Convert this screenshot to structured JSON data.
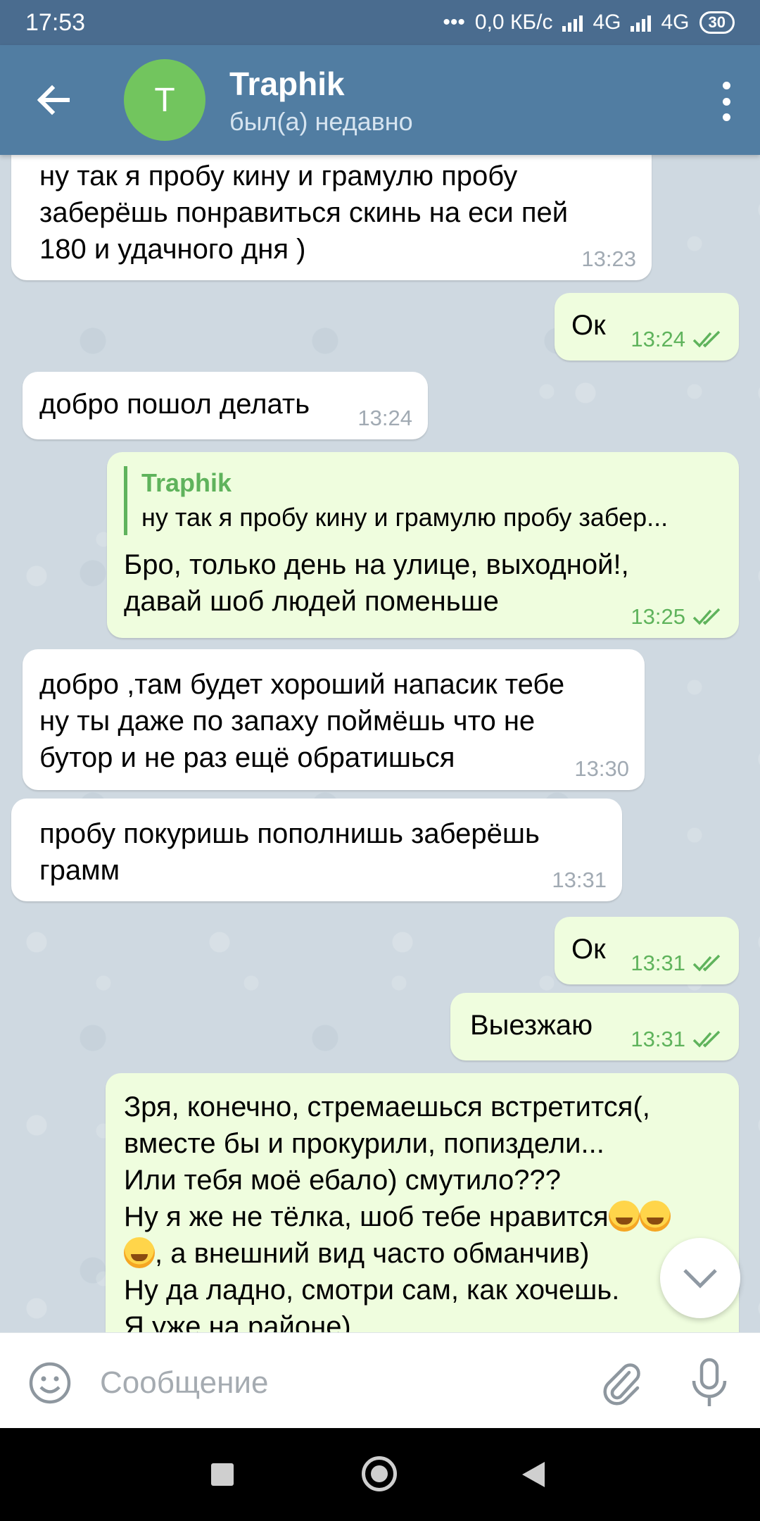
{
  "status_bar": {
    "time": "17:53",
    "dots": "•••",
    "network_speed": "0,0 КБ/с",
    "sim1": "4G",
    "sim2": "4G",
    "battery": "30"
  },
  "header": {
    "avatar_letter": "T",
    "title": "Traphik",
    "subtitle": "был(а) недавно"
  },
  "messages": [
    {
      "dir": "in",
      "text": "ну так я пробу кину и грамулю пробу\nзаберёшь понравиться скинь на еси пей\n180 и удачного дня )",
      "time": "13:23"
    },
    {
      "dir": "out",
      "text": "Ок",
      "time": "13:24"
    },
    {
      "dir": "in",
      "text": "добро пошол делать",
      "time": "13:24"
    },
    {
      "dir": "out",
      "reply_name": "Traphik",
      "reply_text": "ну так я пробу кину и грамулю пробу забер...",
      "text": "Бро, только день на улице, выходной!,\nдавай шоб людей поменьше",
      "time": "13:25"
    },
    {
      "dir": "in",
      "text": "добро ,там будет хороший напасик тебе\nну ты даже по запаху поймёшь что не\nбутор и не раз ещё обратишься",
      "time": "13:30"
    },
    {
      "dir": "in",
      "text": "пробу покуришь пополнишь заберёшь\nграмм",
      "time": "13:31"
    },
    {
      "dir": "out",
      "text": "Ок",
      "time": "13:31"
    },
    {
      "dir": "out",
      "text": "Выезжаю",
      "time": "13:31"
    },
    {
      "dir": "out",
      "line1": "Зря, конечно, стремаешься встретится(,",
      "line2": "вместе бы и прокурили, попиздели...",
      "line3": "Или тебя моё ебало) смутило???",
      "line4": "Ну я же не тёлка, шоб тебе нравится",
      "line5": ", а внешний вид часто обманчив)",
      "line6": "Ну да ладно, смотри сам, как хочешь.",
      "line7": "Я уже на районе)"
    }
  ],
  "input": {
    "placeholder": "Сообщение"
  },
  "colors": {
    "header": "#517da2",
    "status_bar": "#4a6c8f",
    "incoming_bubble": "#ffffff",
    "outgoing_bubble": "#effdde",
    "accent_green": "#5fb35c"
  },
  "icons": [
    "back-arrow-icon",
    "more-vert-icon",
    "double-check-icon",
    "chevron-down-icon",
    "smile-icon",
    "paperclip-icon",
    "mic-icon",
    "rofl-emoji",
    "joy-emoji"
  ]
}
